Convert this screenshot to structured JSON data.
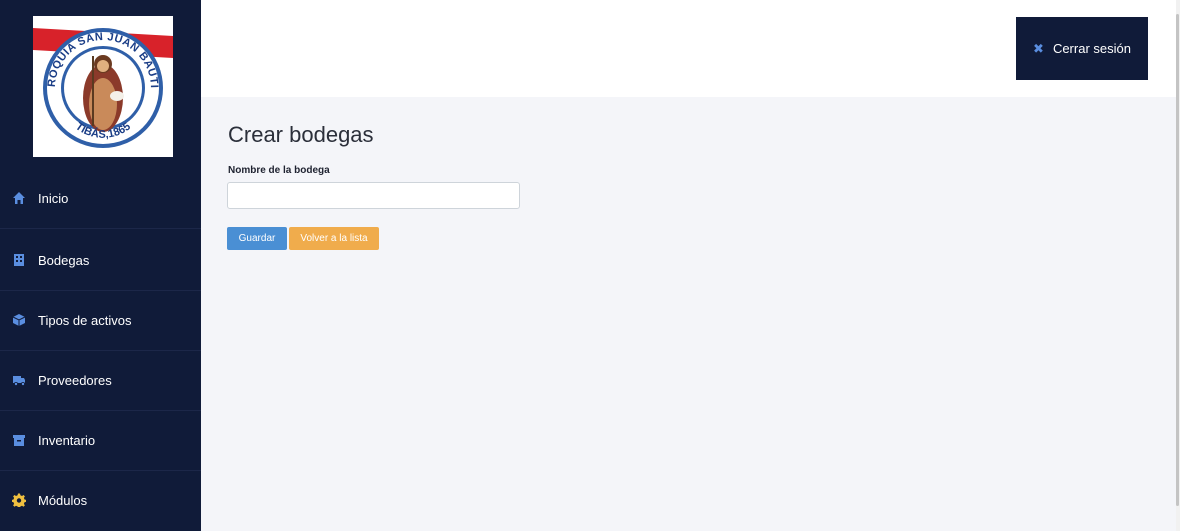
{
  "logo": {
    "top_text": "PARROQUIA SAN JUAN BAUTISTA",
    "bottom_text": "TIBÁS,1865"
  },
  "sidebar": {
    "items": [
      {
        "label": "Inicio",
        "icon": "home-icon"
      },
      {
        "label": "Bodegas",
        "icon": "building-icon"
      },
      {
        "label": "Tipos de activos",
        "icon": "cube-icon"
      },
      {
        "label": "Proveedores",
        "icon": "truck-icon"
      },
      {
        "label": "Inventario",
        "icon": "archive-icon"
      },
      {
        "label": "Módulos",
        "icon": "gear-icon"
      }
    ]
  },
  "header": {
    "logout_label": "Cerrar sesión",
    "logout_icon": "close-icon"
  },
  "main": {
    "title": "Crear bodegas",
    "field_label": "Nombre de la bodega",
    "field_value": "",
    "save_label": "Guardar",
    "back_label": "Volver a la lista"
  },
  "colors": {
    "sidebar_bg": "#101b39",
    "content_bg": "#f4f5f9",
    "primary": "#4a8fd4",
    "warning": "#f0ac4c",
    "icon_blue": "#5a8ee0"
  }
}
